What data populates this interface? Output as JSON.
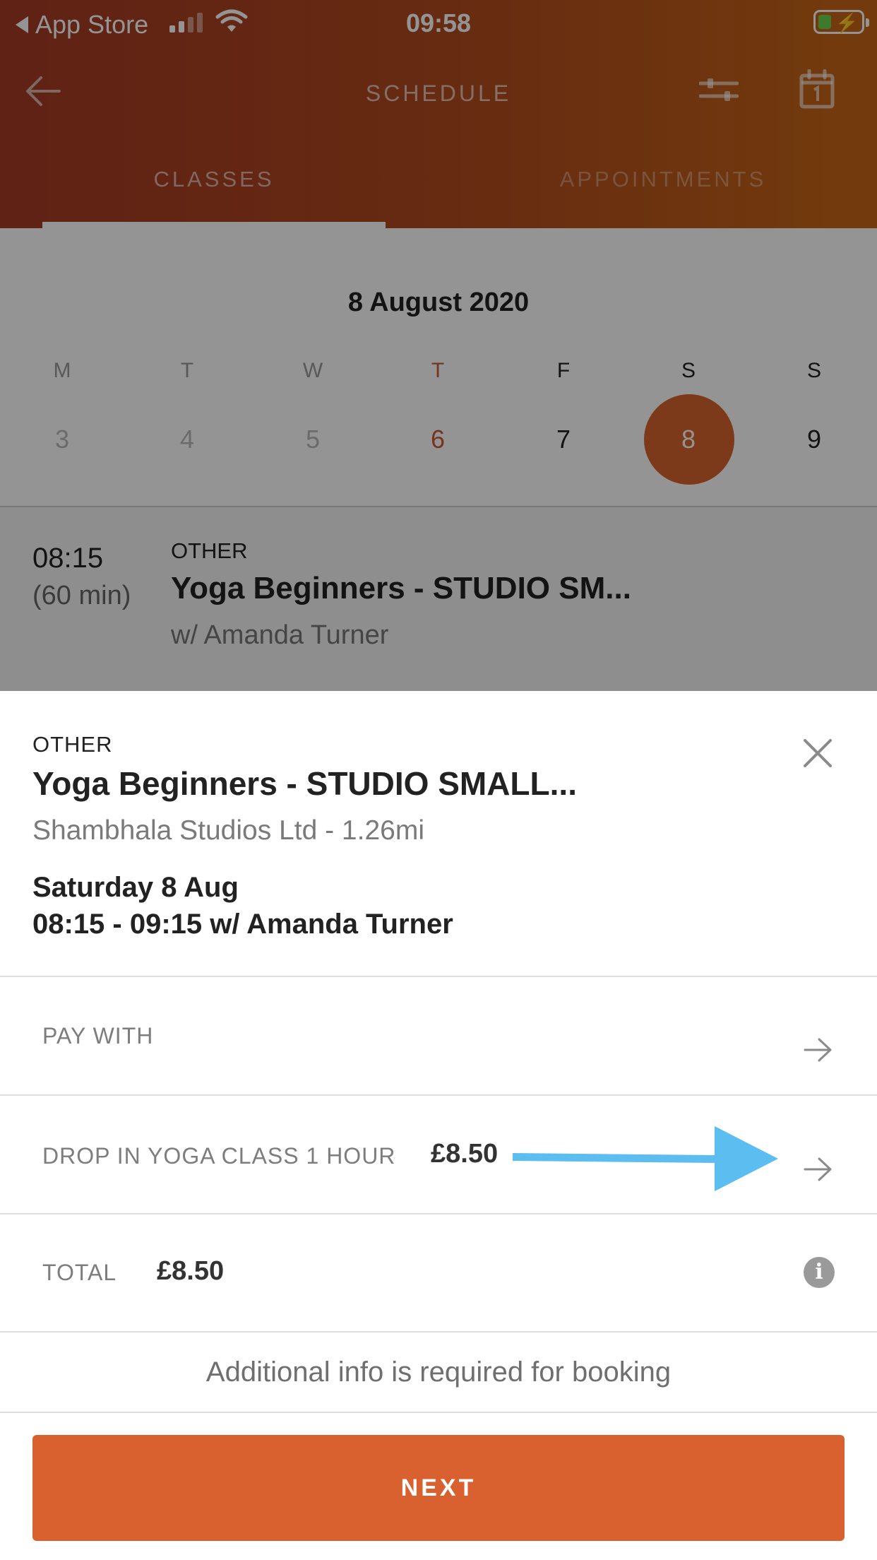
{
  "status_bar": {
    "back_label": "App Store",
    "time": "09:58"
  },
  "nav": {
    "title": "SCHEDULE",
    "tabs": [
      {
        "label": "CLASSES",
        "active": true
      },
      {
        "label": "APPOINTMENTS",
        "active": false
      }
    ]
  },
  "calendar": {
    "month_label": "8 August 2020",
    "weekdays": [
      "M",
      "T",
      "W",
      "T",
      "F",
      "S",
      "S"
    ],
    "days": [
      "3",
      "4",
      "5",
      "6",
      "7",
      "8",
      "9"
    ],
    "today_index": 3,
    "selected_index": 5
  },
  "class_row": {
    "time": "08:15",
    "duration": "(60 min)",
    "category": "OTHER",
    "name": "Yoga Beginners - STUDIO SM...",
    "instructor": "w/ Amanda Turner"
  },
  "sheet": {
    "category": "OTHER",
    "title": "Yoga Beginners - STUDIO SMALL...",
    "venue": "Shambhala Studios Ltd - 1.26mi",
    "date": "Saturday 8 Aug",
    "time": "08:15 - 09:15 w/ Amanda Turner",
    "pay_with_label": "PAY WITH",
    "option_label": "DROP IN YOGA CLASS 1 HOUR",
    "option_price": "£8.50",
    "total_label": "TOTAL",
    "total_value": "£8.50",
    "info_glyph": "i",
    "additional_info": "Additional info is required for booking",
    "next_label": "NEXT"
  },
  "colors": {
    "accent": "#d8612f",
    "header_start": "#a53b24",
    "header_end": "#c76717",
    "annotation_arrow": "#5bbdf0"
  },
  "icons": [
    "back-arrow-icon",
    "filter-icon",
    "calendar-icon",
    "close-icon",
    "chevron-right-icon",
    "info-icon",
    "wifi-icon",
    "battery-icon",
    "signal-icon"
  ]
}
